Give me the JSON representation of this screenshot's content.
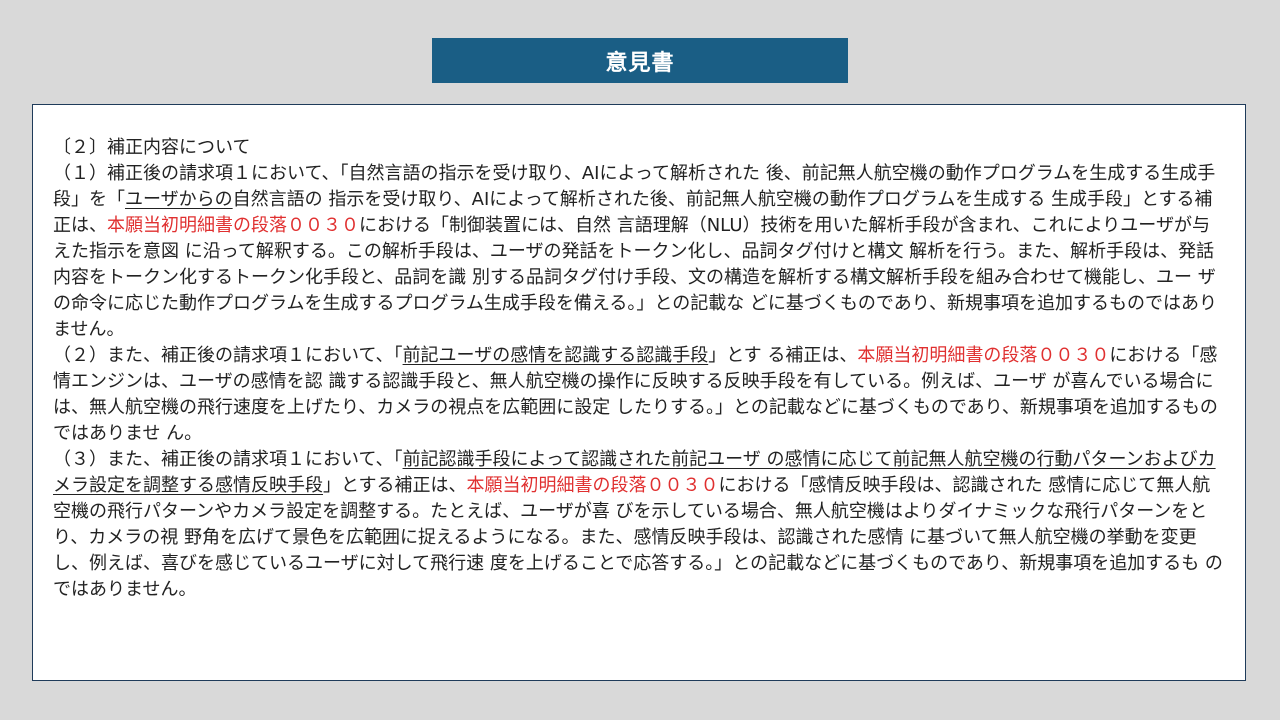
{
  "title": "意見書",
  "colors": {
    "title_bg": "#1a5e85",
    "border": "#1f3b5a",
    "highlight": "#e03030"
  },
  "body": {
    "heading": "〔２〕補正内容について",
    "p1": {
      "a": "（１）補正後の請求項１において、「自然言語の指示を受け取り、AIによって解析された 後、前記無人航空機の動作プログラムを生成する生成手段」を「",
      "b": "ユーザからの",
      "c": "自然言語の 指示を受け取り、AIによって解析された後、前記無人航空機の動作プログラムを生成する 生成手段」とする補正は、",
      "d": "本願当初明細書の段落００３０",
      "e": "における「制御装置には、自然 言語理解（NLU）技術を用いた解析手段が含まれ、これによりユーザが与えた指示を意図 に沿って解釈する。この解析手段は、ユーザの発話をトークン化し、品詞タグ付けと構文 解析を行う。また、解析手段は、発話内容をトークン化するトークン化手段と、品詞を識 別する品詞タグ付け手段、文の構造を解析する構文解析手段を組み合わせて機能し、ユー ザの命令に応じた動作プログラムを生成するプログラム生成手段を備える。」との記載な どに基づくものであり、新規事項を追加するものではありません。"
    },
    "p2": {
      "a": "（２）また、補正後の請求項１において、「",
      "b": "前記ユーザの感情を認識する認識手段",
      "c": "」とす る補正は、",
      "d": "本願当初明細書の段落００３０",
      "e": "における「感情エンジンは、ユーザの感情を認 識する認識手段と、無人航空機の操作に反映する反映手段を有している。例えば、ユーザ が喜んでいる場合には、無人航空機の飛行速度を上げたり、カメラの視点を広範囲に設定 したりする。」との記載などに基づくものであり、新規事項を追加するものではありませ ん。"
    },
    "p3": {
      "a": "（３）また、補正後の請求項１において、「",
      "b": "前記認識手段によって認識された前記ユーザ の感情に応じて前記無人航空機の行動パターンおよびカメラ設定を調整する感情反映手段",
      "c": "」とする補正は、",
      "d": "本願当初明細書の段落００３０",
      "e": "における「感情反映手段は、認識された 感情に応じて無人航空機の飛行パターンやカメラ設定を調整する。たとえば、ユーザが喜 びを示している場合、無人航空機はよりダイナミックな飛行パターンをとり、カメラの視 野角を広げて景色を広範囲に捉えるようになる。また、感情反映手段は、認識された感情 に基づいて無人航空機の挙動を変更し、例えば、喜びを感じているユーザに対して飛行速 度を上げることで応答する。」との記載などに基づくものであり、新規事項を追加するも のではありません。"
    }
  }
}
